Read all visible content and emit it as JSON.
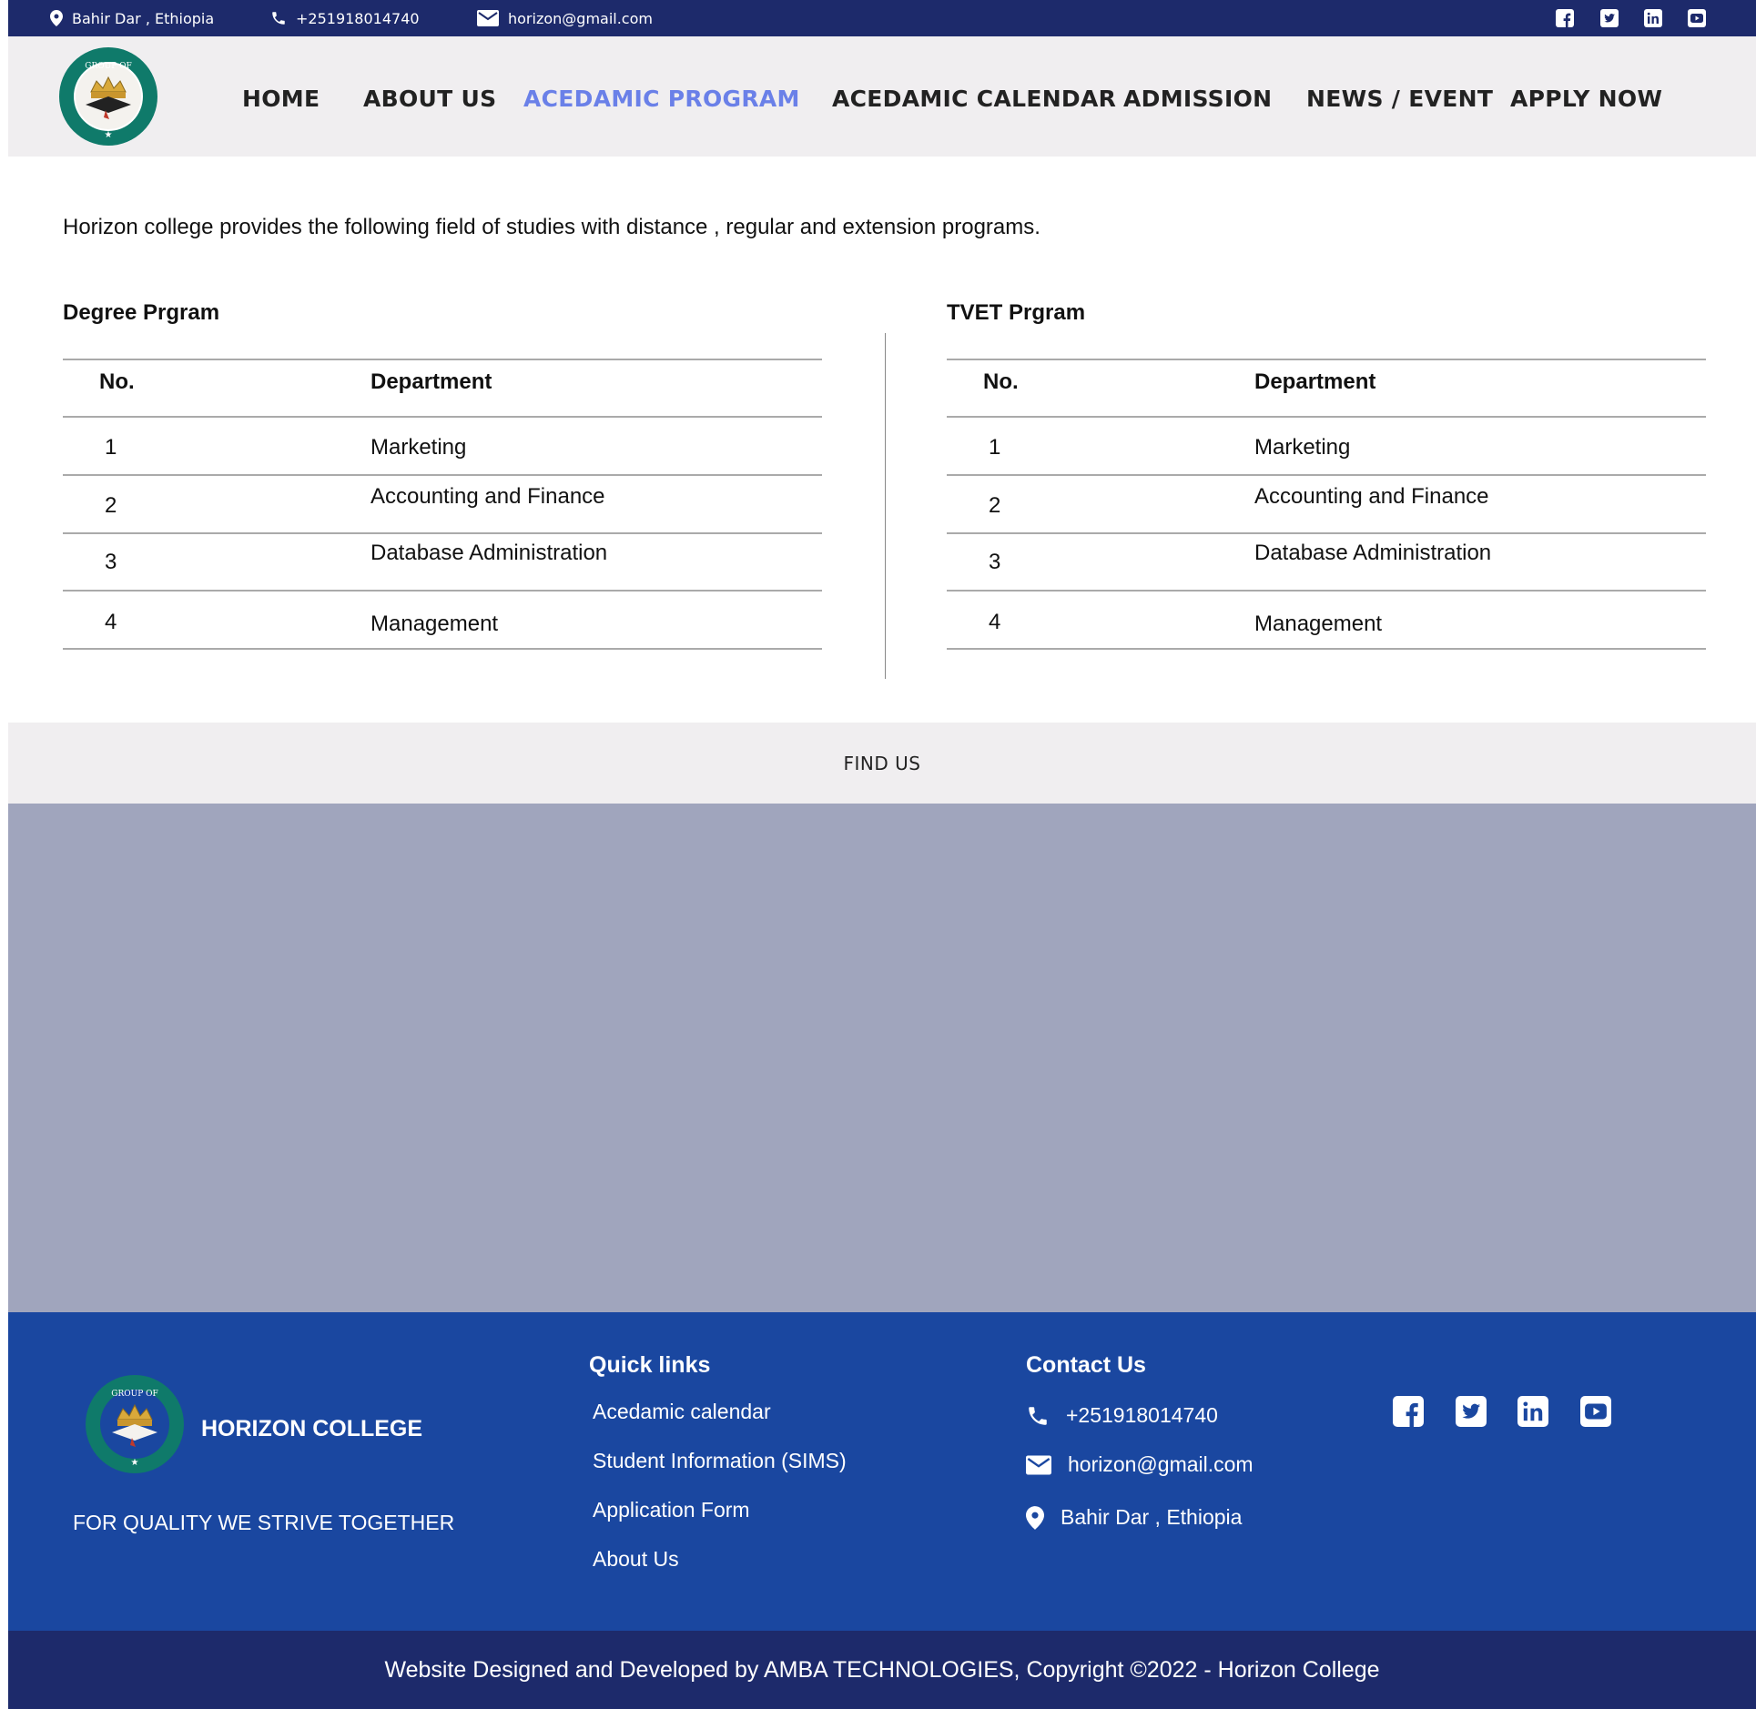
{
  "topbar": {
    "location": "Bahir Dar , Ethiopia",
    "phone": "+251918014740",
    "email": "horizon@gmail.com",
    "social_icons": [
      "facebook-icon",
      "twitter-icon",
      "linkedin-icon",
      "youtube-icon"
    ]
  },
  "nav": {
    "items": [
      {
        "label": "HOME",
        "active": false
      },
      {
        "label": "ABOUT US",
        "active": false
      },
      {
        "label": "ACEDAMIC PROGRAM",
        "active": true
      },
      {
        "label": "ACEDAMIC CALENDAR",
        "active": false
      },
      {
        "label": "ADMISSION",
        "active": false
      },
      {
        "label": "NEWS / EVENT",
        "active": false
      },
      {
        "label": "APPLY NOW",
        "active": false
      }
    ]
  },
  "content": {
    "intro": "Horizon college provides the following field of studies with distance , regular and extension programs.",
    "degree": {
      "title": "Degree Prgram",
      "headers": {
        "no": "No.",
        "dept": "Department"
      },
      "rows": [
        {
          "no": "1",
          "dept": "Marketing"
        },
        {
          "no": "2",
          "dept": "Accounting and Finance"
        },
        {
          "no": "3",
          "dept": "Database Administration"
        },
        {
          "no": "4",
          "dept": "Management"
        }
      ]
    },
    "tvet": {
      "title": "TVET Prgram",
      "headers": {
        "no": "No.",
        "dept": "Department"
      },
      "rows": [
        {
          "no": "1",
          "dept": "Marketing"
        },
        {
          "no": "2",
          "dept": "Accounting and Finance"
        },
        {
          "no": "3",
          "dept": "Database Administration"
        },
        {
          "no": "4",
          "dept": "Management"
        }
      ]
    }
  },
  "find_us": {
    "label": "FIND US"
  },
  "footer": {
    "brand": "HORIZON COLLEGE",
    "tagline": "FOR QUALITY WE STRIVE TOGETHER",
    "quick_links_title": "Quick links",
    "quick_links": [
      "Acedamic calendar",
      "Student Information (SIMS)",
      "Application Form",
      "About Us"
    ],
    "contact_title": "Contact Us",
    "contact_phone": "+251918014740",
    "contact_email": "horizon@gmail.com",
    "contact_location": "Bahir Dar , Ethiopia",
    "copyright": "Website Designed and Developed by AMBA TECHNOLOGIES,  Copyright ©2022 - Horizon College"
  },
  "colors": {
    "topbar_bg": "#1d2a6b",
    "nav_bg": "#f0eef0",
    "nav_active": "#6a80e8",
    "map_placeholder": "#a0a5bd",
    "footer_bg": "#1a47a0",
    "copyright_bg": "#1d2a6b"
  }
}
